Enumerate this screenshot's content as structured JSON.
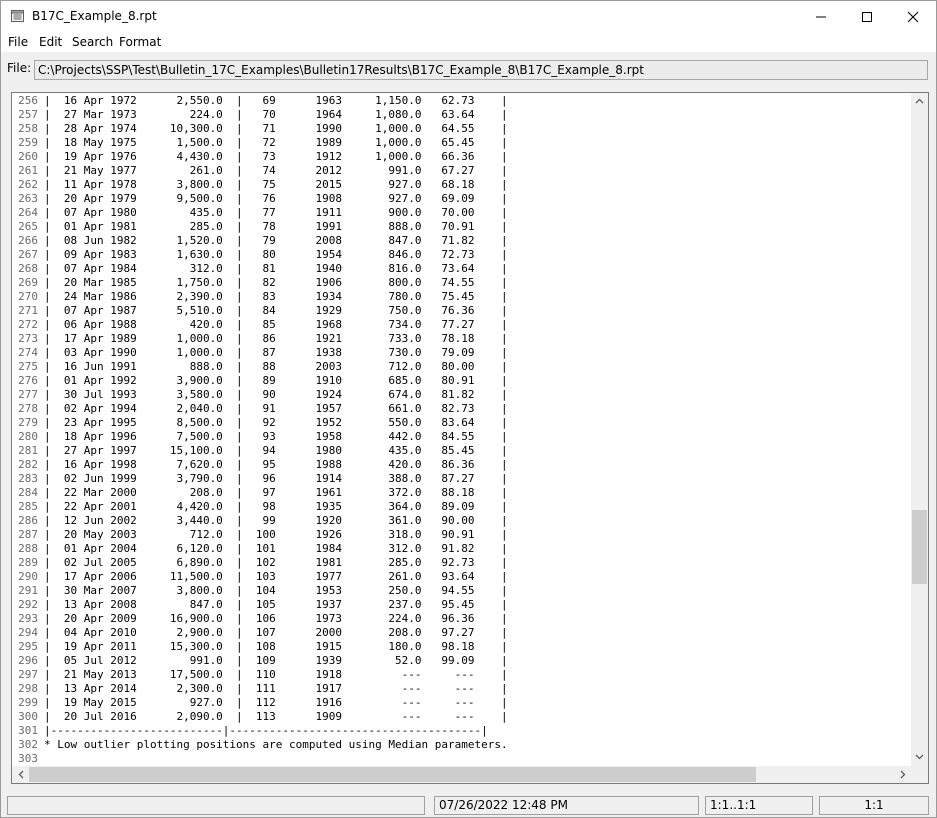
{
  "window": {
    "title": "B17C_Example_8.rpt"
  },
  "menu": [
    "File",
    "Edit",
    "Search",
    "Format"
  ],
  "file_bar": {
    "label": "File:",
    "path": "C:\\Projects\\SSP\\Test\\Bulletin_17C_Examples\\Bulletin17Results\\B17C_Example_8\\B17C_Example_8.rpt"
  },
  "report_lines": [
    {
      "n": "256",
      "t": "|  16 Apr 1972      2,550.0  |   69      1963     1,150.0   62.73    |"
    },
    {
      "n": "257",
      "t": "|  27 Mar 1973        224.0  |   70      1964     1,080.0   63.64    |"
    },
    {
      "n": "258",
      "t": "|  28 Apr 1974     10,300.0  |   71      1990     1,000.0   64.55    |"
    },
    {
      "n": "259",
      "t": "|  18 May 1975      1,500.0  |   72      1989     1,000.0   65.45    |"
    },
    {
      "n": "260",
      "t": "|  19 Apr 1976      4,430.0  |   73      1912     1,000.0   66.36    |"
    },
    {
      "n": "261",
      "t": "|  21 May 1977        261.0  |   74      2012       991.0   67.27    |"
    },
    {
      "n": "262",
      "t": "|  11 Apr 1978      3,800.0  |   75      2015       927.0   68.18    |"
    },
    {
      "n": "263",
      "t": "|  20 Apr 1979      9,500.0  |   76      1908       927.0   69.09    |"
    },
    {
      "n": "264",
      "t": "|  07 Apr 1980        435.0  |   77      1911       900.0   70.00    |"
    },
    {
      "n": "265",
      "t": "|  01 Apr 1981        285.0  |   78      1991       888.0   70.91    |"
    },
    {
      "n": "266",
      "t": "|  08 Jun 1982      1,520.0  |   79      2008       847.0   71.82    |"
    },
    {
      "n": "267",
      "t": "|  09 Apr 1983      1,630.0  |   80      1954       846.0   72.73    |"
    },
    {
      "n": "268",
      "t": "|  07 Apr 1984        312.0  |   81      1940       816.0   73.64    |"
    },
    {
      "n": "269",
      "t": "|  20 Mar 1985      1,750.0  |   82      1906       800.0   74.55    |"
    },
    {
      "n": "270",
      "t": "|  24 Mar 1986      2,390.0  |   83      1934       780.0   75.45    |"
    },
    {
      "n": "271",
      "t": "|  07 Apr 1987      5,510.0  |   84      1929       750.0   76.36    |"
    },
    {
      "n": "272",
      "t": "|  06 Apr 1988        420.0  |   85      1968       734.0   77.27    |"
    },
    {
      "n": "273",
      "t": "|  17 Apr 1989      1,000.0  |   86      1921       733.0   78.18    |"
    },
    {
      "n": "274",
      "t": "|  03 Apr 1990      1,000.0  |   87      1938       730.0   79.09    |"
    },
    {
      "n": "275",
      "t": "|  16 Jun 1991        888.0  |   88      2003       712.0   80.00    |"
    },
    {
      "n": "276",
      "t": "|  01 Apr 1992      3,900.0  |   89      1910       685.0   80.91    |"
    },
    {
      "n": "277",
      "t": "|  30 Jul 1993      3,580.0  |   90      1924       674.0   81.82    |"
    },
    {
      "n": "278",
      "t": "|  02 Apr 1994      2,040.0  |   91      1957       661.0   82.73    |"
    },
    {
      "n": "279",
      "t": "|  23 Apr 1995      8,500.0  |   92      1952       550.0   83.64    |"
    },
    {
      "n": "280",
      "t": "|  18 Apr 1996      7,500.0  |   93      1958       442.0   84.55    |"
    },
    {
      "n": "281",
      "t": "|  27 Apr 1997     15,100.0  |   94      1980       435.0   85.45    |"
    },
    {
      "n": "282",
      "t": "|  16 Apr 1998      7,620.0  |   95      1988       420.0   86.36    |"
    },
    {
      "n": "283",
      "t": "|  02 Jun 1999      3,790.0  |   96      1914       388.0   87.27    |"
    },
    {
      "n": "284",
      "t": "|  22 Mar 2000        208.0  |   97      1961       372.0   88.18    |"
    },
    {
      "n": "285",
      "t": "|  22 Apr 2001      4,420.0  |   98      1935       364.0   89.09    |"
    },
    {
      "n": "286",
      "t": "|  12 Jun 2002      3,440.0  |   99      1920       361.0   90.00    |"
    },
    {
      "n": "287",
      "t": "|  20 May 2003        712.0  |  100      1926       318.0   90.91    |"
    },
    {
      "n": "288",
      "t": "|  01 Apr 2004      6,120.0  |  101      1984       312.0   91.82    |"
    },
    {
      "n": "289",
      "t": "|  02 Jul 2005      6,890.0  |  102      1981       285.0   92.73    |"
    },
    {
      "n": "290",
      "t": "|  17 Apr 2006     11,500.0  |  103      1977       261.0   93.64    |"
    },
    {
      "n": "291",
      "t": "|  30 Mar 2007      3,800.0  |  104      1953       250.0   94.55    |"
    },
    {
      "n": "292",
      "t": "|  13 Apr 2008        847.0  |  105      1937       237.0   95.45    |"
    },
    {
      "n": "293",
      "t": "|  20 Apr 2009     16,900.0  |  106      1973       224.0   96.36    |"
    },
    {
      "n": "294",
      "t": "|  04 Apr 2010      2,900.0  |  107      2000       208.0   97.27    |"
    },
    {
      "n": "295",
      "t": "|  19 Apr 2011     15,300.0  |  108      1915       180.0   98.18    |"
    },
    {
      "n": "296",
      "t": "|  05 Jul 2012        991.0  |  109      1939        52.0   99.09    |"
    },
    {
      "n": "297",
      "t": "|  21 May 2013     17,500.0  |  110      1918         ---     ---    |"
    },
    {
      "n": "298",
      "t": "|  13 Apr 2014      2,300.0  |  111      1917         ---     ---    |"
    },
    {
      "n": "299",
      "t": "|  19 May 2015        927.0  |  112      1916         ---     ---    |"
    },
    {
      "n": "300",
      "t": "|  20 Jul 2016      2,090.0  |  113      1909         ---     ---    |"
    },
    {
      "n": "301",
      "t": "|--------------------------|--------------------------------------|"
    },
    {
      "n": "302",
      "t": "* Low outlier plotting positions are computed using Median parameters."
    },
    {
      "n": "303",
      "t": ""
    }
  ],
  "status": {
    "message": "",
    "timestamp": "07/26/2022 12:48 PM",
    "position": "1:1..1:1",
    "zoom": "1:1"
  },
  "icons": {
    "app": "report-file-icon",
    "minimize": "minimize-icon",
    "maximize": "maximize-icon",
    "close": "close-icon"
  },
  "colors": {
    "title_bg": "#ffffff",
    "chrome_bg": "#f0f0f0",
    "line_number": "#6a6a6a",
    "scroll_thumb": "#cdcdcd"
  }
}
